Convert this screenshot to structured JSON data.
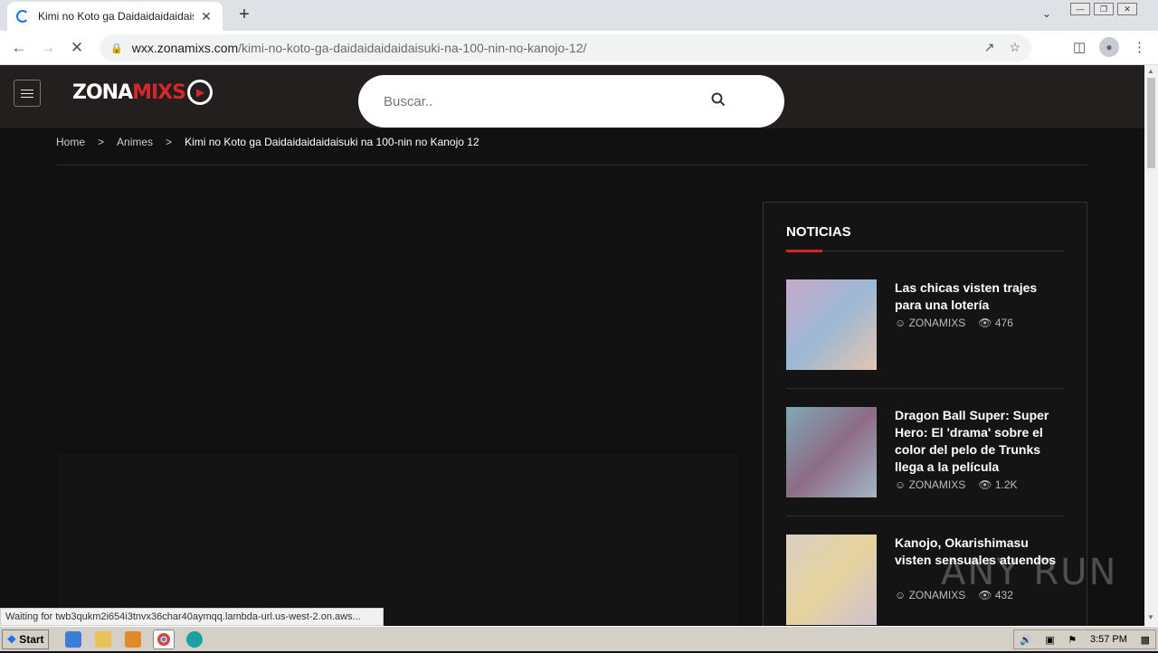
{
  "browser": {
    "tab_title": "Kimi no Koto ga Daidaidaidaidaisuki n",
    "tab_close": "✕",
    "new_tab": "+",
    "url_host": "wxx.zonamixs.com",
    "url_path": "/kimi-no-koto-ga-daidaidaidaidaisuki-na-100-nin-no-kanojo-12/",
    "status": "Waiting for twb3qukm2i654i3tnvx36char40aymqq.lambda-url.us-west-2.on.aws..."
  },
  "site": {
    "logo_left": "ZONA",
    "logo_right": "MIXS",
    "search_placeholder": "Buscar.."
  },
  "breadcrumb": {
    "home": "Home",
    "section": "Animes",
    "current": "Kimi no Koto ga Daidaidaidaidaisuki na 100-nin no Kanojo 12",
    "sep": ">"
  },
  "sidebar": {
    "title": "NOTICIAS",
    "items": [
      {
        "title": "Las chicas visten trajes para una lotería",
        "author": "ZONAMIXS",
        "views": "476"
      },
      {
        "title": "Dragon Ball Super: Super Hero: El 'drama' sobre el color del pelo de Trunks llega a la película",
        "author": "ZONAMIXS",
        "views": "1.2K"
      },
      {
        "title": "Kanojo, Okarishimasu visten sensuales atuendos",
        "author": "ZONAMIXS",
        "views": "432"
      }
    ]
  },
  "watermark": "ANY RUN",
  "taskbar": {
    "start": "Start",
    "time": "3:57 PM"
  }
}
